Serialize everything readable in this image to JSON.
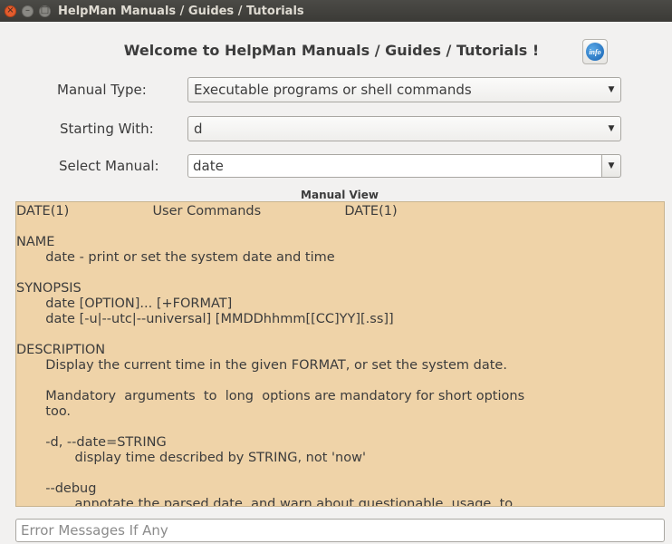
{
  "window": {
    "title": "HelpMan Manuals / Guides / Tutorials",
    "close_glyph": "×",
    "minimize_glyph": "–",
    "maximize_glyph": "□"
  },
  "header": {
    "welcome": "Welcome to HelpMan Manuals / Guides / Tutorials !",
    "info_icon": "info"
  },
  "form": {
    "manual_type_label": "Manual Type:",
    "manual_type_value": "Executable programs or shell commands",
    "starting_with_label": "Starting With:",
    "starting_with_value": "d",
    "select_manual_label": "Select Manual:",
    "select_manual_value": "date",
    "arrow_glyph": "▼"
  },
  "manual_view": {
    "title": "Manual View",
    "text": "DATE(1)                    User Commands                    DATE(1)\n\nNAME\n       date - print or set the system date and time\n\nSYNOPSIS\n       date [OPTION]... [+FORMAT]\n       date [-u|--utc|--universal] [MMDDhhmm[[CC]YY][.ss]]\n\nDESCRIPTION\n       Display the current time in the given FORMAT, or set the system date.\n\n       Mandatory  arguments  to  long  options are mandatory for short options\n       too.\n\n       -d, --date=STRING\n              display time described by STRING, not 'now'\n\n       --debug\n              annotate the parsed date, and warn about questionable  usage  to"
  },
  "footer": {
    "error_placeholder": "Error Messages If Any"
  }
}
